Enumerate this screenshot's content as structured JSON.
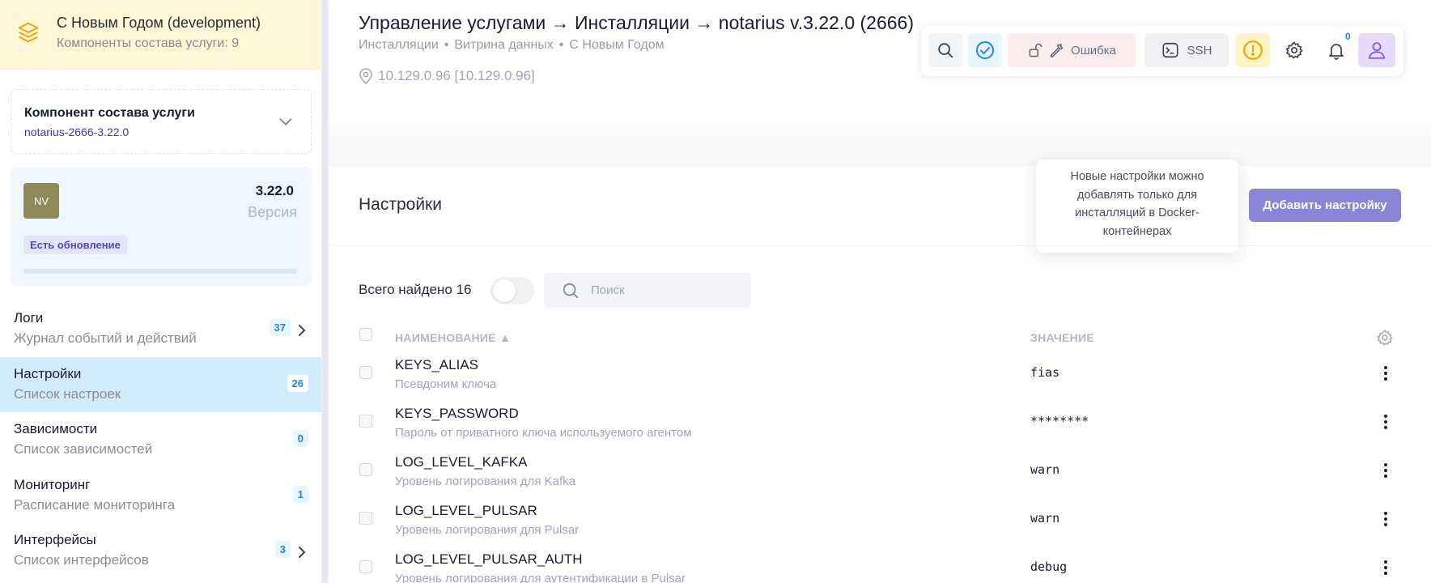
{
  "service": {
    "title": "С Новым Годом (development)",
    "subtitle": "Компоненты состава услуги: 9"
  },
  "component": {
    "label": "Компонент состава услуги",
    "value": "notarius-2666-3.22.0"
  },
  "version_card": {
    "avatar": "NV",
    "version": "3.22.0",
    "version_label": "Версия",
    "badge": "Есть обновление"
  },
  "nav": [
    {
      "title": "Логи",
      "subtitle": "Журнал событий и действий",
      "count": "37"
    },
    {
      "title": "Настройки",
      "subtitle": "Список настроек",
      "count": "26"
    },
    {
      "title": "Зависимости",
      "subtitle": "Список зависимостей",
      "count": "0"
    },
    {
      "title": "Мониторинг",
      "subtitle": "Расписание мониторинга",
      "count": "1"
    },
    {
      "title": "Интерфейсы",
      "subtitle": "Список интерфейсов",
      "count": "3"
    }
  ],
  "header": {
    "title": "Управление услугами → Инсталляции → notarius v.3.22.0 (2666)",
    "crumbs": [
      "Инсталляции",
      "Витрина данных",
      "С Новым Годом"
    ],
    "crumb_sep": "•",
    "ip": "10.129.0.96 [10.129.0.96]"
  },
  "toolbar": {
    "error_label": "Ошибка",
    "ssh_label": "SSH",
    "bell_count": "0"
  },
  "settings": {
    "title": "Настройки",
    "add_button": "Добавить настройку",
    "tooltip": "Новые настройки можно добавлять только для инсталляций в Docker-контейнерах",
    "found_label": "Всего найдено 16",
    "search_placeholder": "Поиск",
    "col_name": "НАИМЕНОВАНИЕ ▲",
    "col_value": "ЗНАЧЕНИЕ",
    "rows": [
      {
        "name": "KEYS_ALIAS",
        "desc": "Псевдоним ключа",
        "value": "fias"
      },
      {
        "name": "KEYS_PASSWORD",
        "desc": "Пароль от приватного ключа используемого агентом",
        "value": "********"
      },
      {
        "name": "LOG_LEVEL_KAFKA",
        "desc": "Уровень логирования для Kafka",
        "value": "warn"
      },
      {
        "name": "LOG_LEVEL_PULSAR",
        "desc": "Уровень логирования для Pulsar",
        "value": "warn"
      },
      {
        "name": "LOG_LEVEL_PULSAR_AUTH",
        "desc": "Уровень логирования для аутентификации в Pulsar",
        "value": "debug"
      }
    ]
  }
}
